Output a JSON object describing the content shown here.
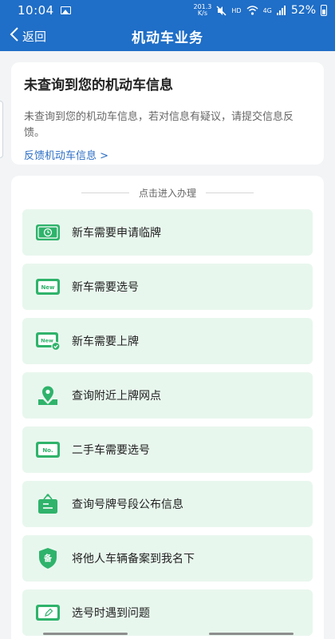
{
  "status": {
    "time": "10:04",
    "net_speed_value": "201.3",
    "net_speed_unit": "K/s",
    "hd": "HD",
    "network": "4G",
    "battery": "52%"
  },
  "nav": {
    "back_label": "返回",
    "title": "机动车业务"
  },
  "info": {
    "title": "未查询到您的机动车信息",
    "description": "未查询到您的机动车信息，若对信息有疑议，请提交信息反馈。",
    "link": "反馈机动车信息 >"
  },
  "services": {
    "section_title": "点击进入办理",
    "items": [
      {
        "label": "新车需要申请临牌",
        "icon": "temp-plate-clock-icon"
      },
      {
        "label": "新车需要选号",
        "icon": "new-plate-icon"
      },
      {
        "label": "新车需要上牌",
        "icon": "new-plate-check-icon"
      },
      {
        "label": "查询附近上牌网点",
        "icon": "location-pin-icon"
      },
      {
        "label": "二手车需要选号",
        "icon": "number-plate-icon"
      },
      {
        "label": "查询号牌号段公布信息",
        "icon": "notice-board-icon"
      },
      {
        "label": "将他人车辆备案到我名下",
        "icon": "shield-record-icon"
      },
      {
        "label": "选号时遇到问题",
        "icon": "plate-edit-icon"
      }
    ]
  },
  "colors": {
    "header": "#1f6ec7",
    "item_bg": "#e8f7ee",
    "icon_green": "#2fb36b",
    "link": "#2d6fc4"
  }
}
